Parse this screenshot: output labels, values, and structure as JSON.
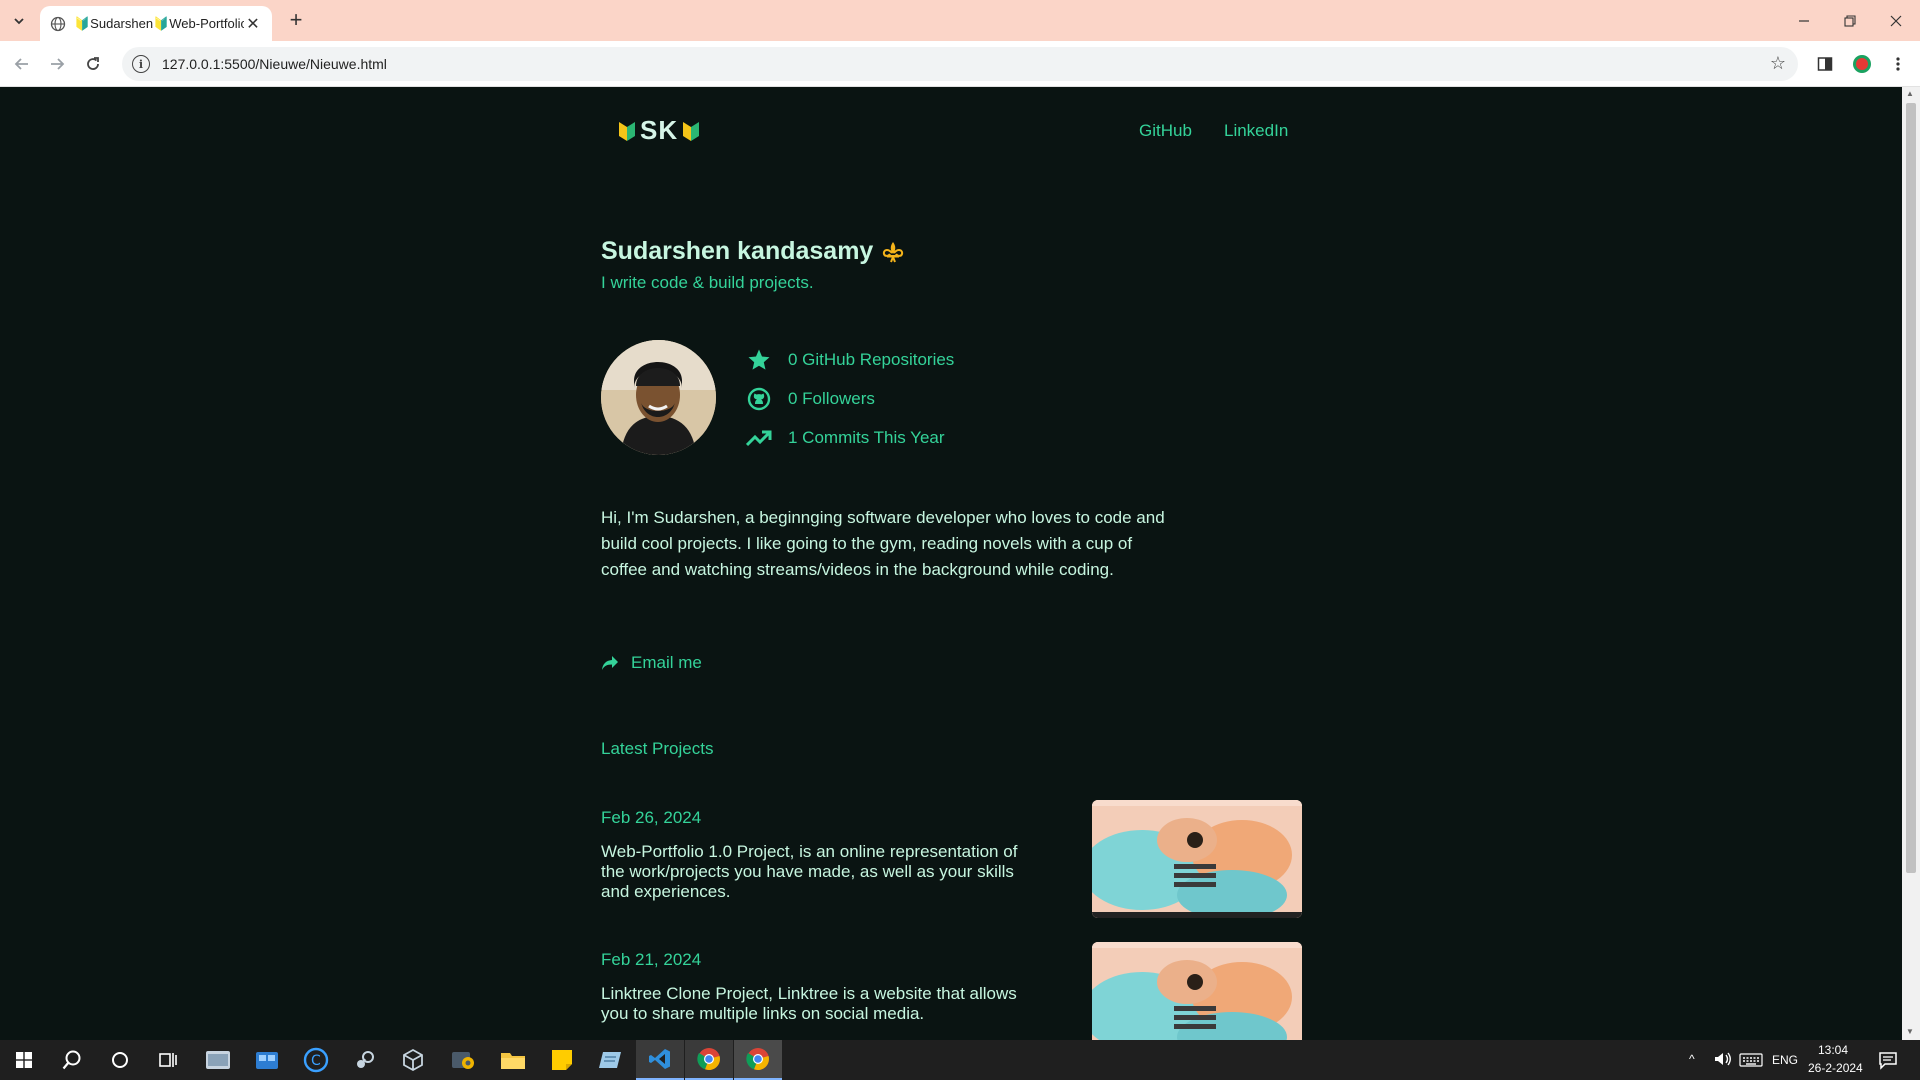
{
  "browser": {
    "tab_title": "🔰Sudarshen🔰Web-Portfolio💼",
    "url": "127.0.0.1:5500/Nieuwe/Nieuwe.html"
  },
  "site": {
    "logo_text": "SK",
    "nav": {
      "github": "GitHub",
      "linkedin": "LinkedIn"
    },
    "name": "Sudarshen kandasamy",
    "name_emoji": "⚜️",
    "tagline": "I write code & build projects.",
    "stats": [
      {
        "icon": "star-icon",
        "label": "0 GitHub Repositories"
      },
      {
        "icon": "github-icon",
        "label": "0 Followers"
      },
      {
        "icon": "trending-up-icon",
        "label": "1 Commits This Year"
      }
    ],
    "bio": "Hi, I'm Sudarshen, a beginnging software developer who loves to code and build cool projects. I like going to the gym, reading novels with a cup of coffee and watching streams/videos in the background while coding.",
    "email_label": "Email me",
    "projects_title": "Latest Projects",
    "projects": [
      {
        "date": "Feb 26, 2024",
        "description": "Web-Portfolio 1.0 Project, is an online representation of the work/projects you have made, as well as your skills and experiences."
      },
      {
        "date": "Feb 21, 2024",
        "description": "Linktree Clone Project, Linktree is a website that allows you to share multiple links on social media."
      }
    ],
    "accent_color": "#34d399",
    "background_color": "#0a1412",
    "text_color": "#c7f6e0"
  },
  "taskbar": {
    "language": "ENG",
    "time": "13:04",
    "date": "26-2-2024"
  }
}
